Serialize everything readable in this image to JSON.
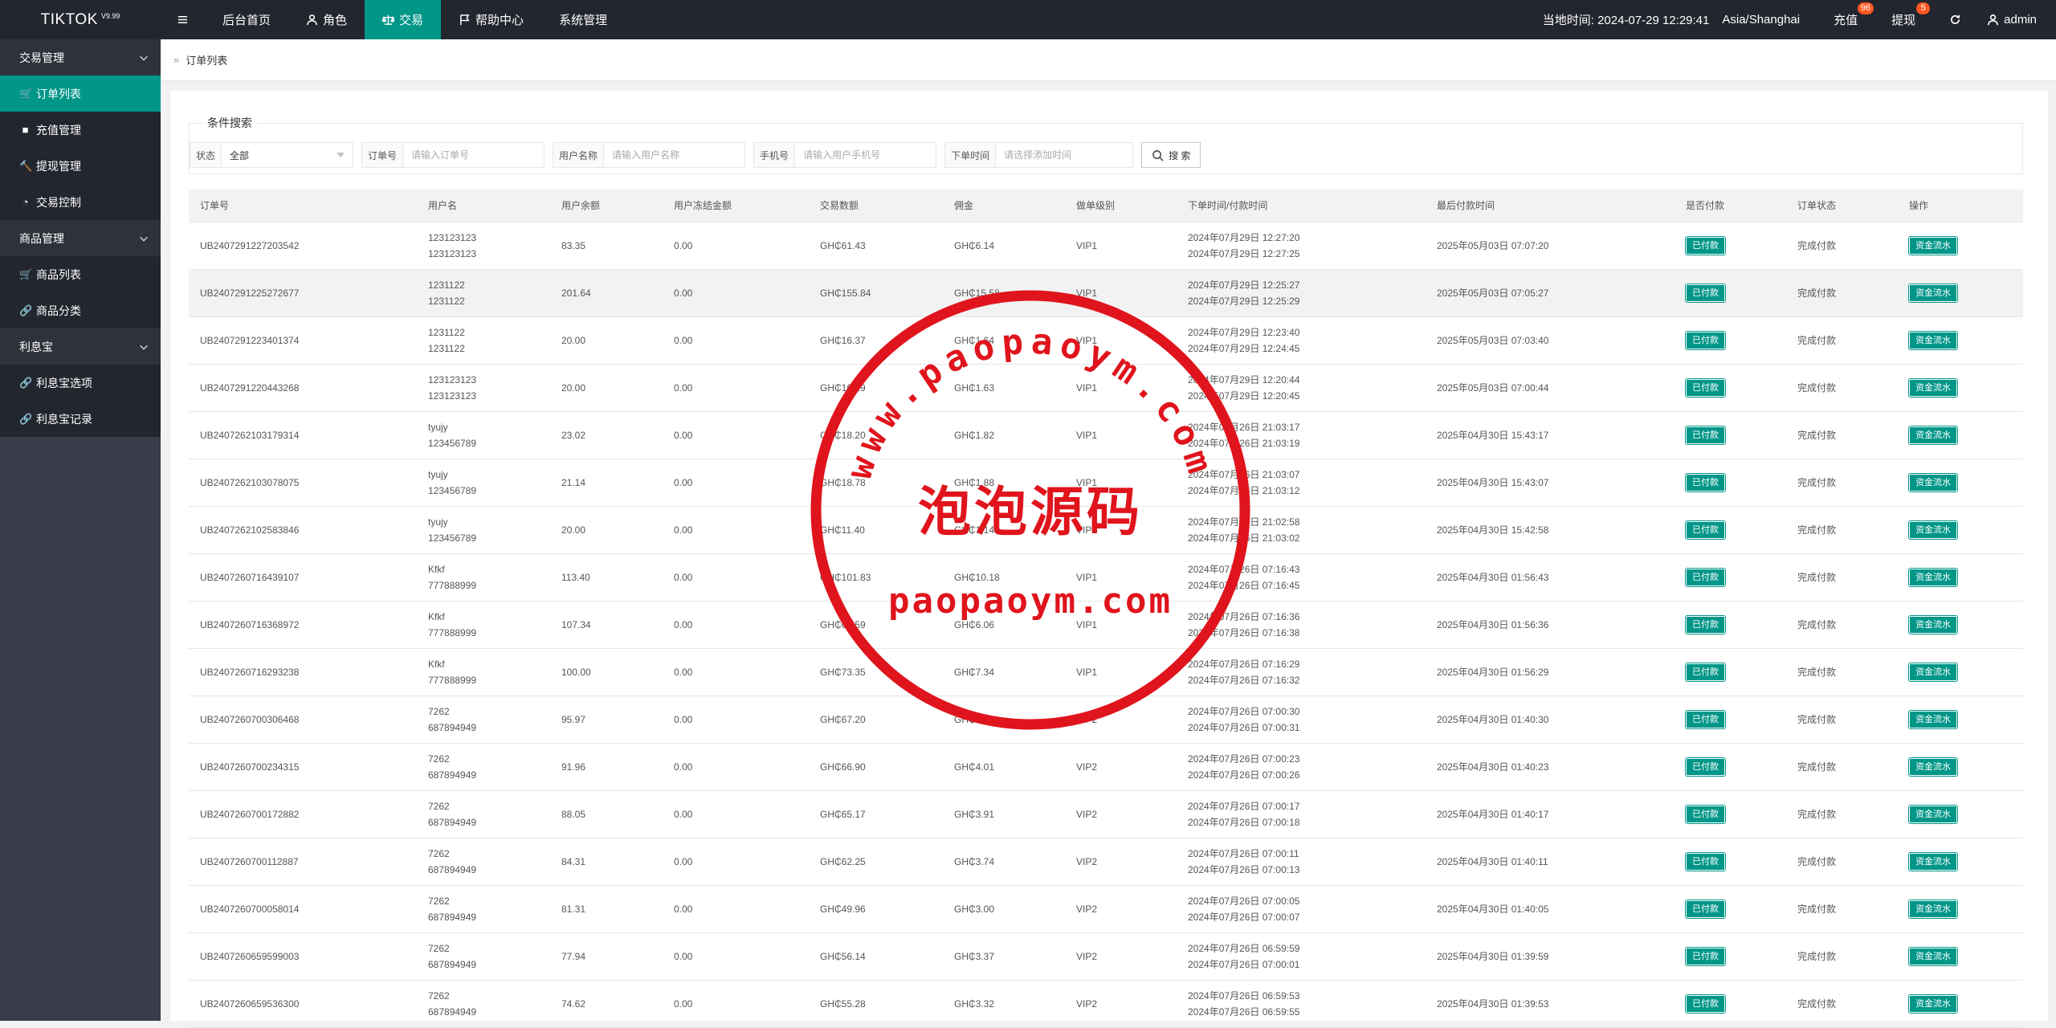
{
  "app": {
    "name": "TIKTOK",
    "version": "V9.99"
  },
  "nav": {
    "menu_icon": "hamburger-icon",
    "items": [
      {
        "label": "后台首页",
        "icon": ""
      },
      {
        "label": "角色",
        "icon": "user-icon"
      },
      {
        "label": "交易",
        "icon": "scale-icon",
        "active": true
      },
      {
        "label": "帮助中心",
        "icon": "flag-icon"
      },
      {
        "label": "系统管理",
        "icon": ""
      }
    ]
  },
  "header_right": {
    "time_label": "当地时间: 2024-07-29 12:29:41",
    "timezone": "Asia/Shanghai",
    "recharge": {
      "label": "充值",
      "badge": "96"
    },
    "withdraw": {
      "label": "提现",
      "badge": "5"
    },
    "user": "admin"
  },
  "sidebar": {
    "groups": [
      {
        "label": "交易管理",
        "items": [
          {
            "label": "订单列表",
            "icon": "cart-icon",
            "active": true
          },
          {
            "label": "充值管理",
            "icon": "comment-icon"
          },
          {
            "label": "提现管理",
            "icon": "hammer-icon"
          },
          {
            "label": "交易控制",
            "icon": "dashboard-icon"
          }
        ]
      },
      {
        "label": "商品管理",
        "items": [
          {
            "label": "商品列表",
            "icon": "cart-icon"
          },
          {
            "label": "商品分类",
            "icon": "link-icon"
          }
        ]
      },
      {
        "label": "利息宝",
        "items": [
          {
            "label": "利息宝选项",
            "icon": "link-icon"
          },
          {
            "label": "利息宝记录",
            "icon": "link-icon"
          }
        ]
      }
    ]
  },
  "breadcrumb": {
    "current": "订单列表"
  },
  "search": {
    "legend": "条件搜索",
    "status_label": "状态",
    "status_value": "全部",
    "order_label": "订单号",
    "order_placeholder": "请输入订单号",
    "username_label": "用户名称",
    "username_placeholder": "请输入用户名称",
    "phone_label": "手机号",
    "phone_placeholder": "请输入用户手机号",
    "time_label": "下单时间",
    "time_placeholder": "请选择添加时间",
    "button": "搜 索"
  },
  "table": {
    "columns": [
      "订单号",
      "用户名",
      "用户余额",
      "用户冻结金额",
      "交易数额",
      "佣金",
      "做单级别",
      "下单时间/付款时间",
      "最后付款时间",
      "是否付款",
      "订单状态",
      "操作"
    ],
    "rows": [
      {
        "id": "UB2407291227203542",
        "user1": "123123123",
        "user2": "123123123",
        "balance": "83.35",
        "frozen": "0.00",
        "amount": "GH₵61.43",
        "commission": "GH₵6.14",
        "level": "VIP1",
        "t1": "2024年07月29日 12:27:20",
        "t2": "2024年07月29日 12:27:25",
        "last": "2025年05月03日 07:07:20",
        "paid": "已付款",
        "status": "完成付款",
        "op": "资金流水"
      },
      {
        "id": "UB2407291225272677",
        "user1": "1231122",
        "user2": "1231122",
        "balance": "201.64",
        "frozen": "0.00",
        "amount": "GH₵155.84",
        "commission": "GH₵15.58",
        "level": "VIP1",
        "t1": "2024年07月29日 12:25:27",
        "t2": "2024年07月29日 12:25:29",
        "last": "2025年05月03日 07:05:27",
        "paid": "已付款",
        "status": "完成付款",
        "op": "资金流水"
      },
      {
        "id": "UB2407291223401374",
        "user1": "1231122",
        "user2": "1231122",
        "balance": "20.00",
        "frozen": "0.00",
        "amount": "GH₵16.37",
        "commission": "GH₵1.64",
        "level": "VIP1",
        "t1": "2024年07月29日 12:23:40",
        "t2": "2024年07月29日 12:24:45",
        "last": "2025年05月03日 07:03:40",
        "paid": "已付款",
        "status": "完成付款",
        "op": "资金流水"
      },
      {
        "id": "UB2407291220443268",
        "user1": "123123123",
        "user2": "123123123",
        "balance": "20.00",
        "frozen": "0.00",
        "amount": "GH₵16.29",
        "commission": "GH₵1.63",
        "level": "VIP1",
        "t1": "2024年07月29日 12:20:44",
        "t2": "2024年07月29日 12:20:45",
        "last": "2025年05月03日 07:00:44",
        "paid": "已付款",
        "status": "完成付款",
        "op": "资金流水"
      },
      {
        "id": "UB2407262103179314",
        "user1": "tyujy",
        "user2": "123456789",
        "balance": "23.02",
        "frozen": "0.00",
        "amount": "GH₵18.20",
        "commission": "GH₵1.82",
        "level": "VIP1",
        "t1": "2024年07月26日 21:03:17",
        "t2": "2024年07月26日 21:03:19",
        "last": "2025年04月30日 15:43:17",
        "paid": "已付款",
        "status": "完成付款",
        "op": "资金流水"
      },
      {
        "id": "UB2407262103078075",
        "user1": "tyujy",
        "user2": "123456789",
        "balance": "21.14",
        "frozen": "0.00",
        "amount": "GH₵18.78",
        "commission": "GH₵1.88",
        "level": "VIP1",
        "t1": "2024年07月26日 21:03:07",
        "t2": "2024年07月26日 21:03:12",
        "last": "2025年04月30日 15:43:07",
        "paid": "已付款",
        "status": "完成付款",
        "op": "资金流水"
      },
      {
        "id": "UB2407262102583846",
        "user1": "tyujy",
        "user2": "123456789",
        "balance": "20.00",
        "frozen": "0.00",
        "amount": "GH₵11.40",
        "commission": "GH₵1.14",
        "level": "VIP1",
        "t1": "2024年07月26日 21:02:58",
        "t2": "2024年07月26日 21:03:02",
        "last": "2025年04月30日 15:42:58",
        "paid": "已付款",
        "status": "完成付款",
        "op": "资金流水"
      },
      {
        "id": "UB2407260716439107",
        "user1": "Kfkf",
        "user2": "777888999",
        "balance": "113.40",
        "frozen": "0.00",
        "amount": "GH₵101.83",
        "commission": "GH₵10.18",
        "level": "VIP1",
        "t1": "2024年07月26日 07:16:43",
        "t2": "2024年07月26日 07:16:45",
        "last": "2025年04月30日 01:56:43",
        "paid": "已付款",
        "status": "完成付款",
        "op": "资金流水"
      },
      {
        "id": "UB2407260716368972",
        "user1": "Kfkf",
        "user2": "777888999",
        "balance": "107.34",
        "frozen": "0.00",
        "amount": "GH₵60.59",
        "commission": "GH₵6.06",
        "level": "VIP1",
        "t1": "2024年07月26日 07:16:36",
        "t2": "2024年07月26日 07:16:38",
        "last": "2025年04月30日 01:56:36",
        "paid": "已付款",
        "status": "完成付款",
        "op": "资金流水"
      },
      {
        "id": "UB2407260716293238",
        "user1": "Kfkf",
        "user2": "777888999",
        "balance": "100.00",
        "frozen": "0.00",
        "amount": "GH₵73.35",
        "commission": "GH₵7.34",
        "level": "VIP1",
        "t1": "2024年07月26日 07:16:29",
        "t2": "2024年07月26日 07:16:32",
        "last": "2025年04月30日 01:56:29",
        "paid": "已付款",
        "status": "完成付款",
        "op": "资金流水"
      },
      {
        "id": "UB2407260700306468",
        "user1": "7262",
        "user2": "687894949",
        "balance": "95.97",
        "frozen": "0.00",
        "amount": "GH₵67.20",
        "commission": "GH₵4.03",
        "level": "VIP2",
        "t1": "2024年07月26日 07:00:30",
        "t2": "2024年07月26日 07:00:31",
        "last": "2025年04月30日 01:40:30",
        "paid": "已付款",
        "status": "完成付款",
        "op": "资金流水"
      },
      {
        "id": "UB2407260700234315",
        "user1": "7262",
        "user2": "687894949",
        "balance": "91.96",
        "frozen": "0.00",
        "amount": "GH₵66.90",
        "commission": "GH₵4.01",
        "level": "VIP2",
        "t1": "2024年07月26日 07:00:23",
        "t2": "2024年07月26日 07:00:26",
        "last": "2025年04月30日 01:40:23",
        "paid": "已付款",
        "status": "完成付款",
        "op": "资金流水"
      },
      {
        "id": "UB2407260700172882",
        "user1": "7262",
        "user2": "687894949",
        "balance": "88.05",
        "frozen": "0.00",
        "amount": "GH₵65.17",
        "commission": "GH₵3.91",
        "level": "VIP2",
        "t1": "2024年07月26日 07:00:17",
        "t2": "2024年07月26日 07:00:18",
        "last": "2025年04月30日 01:40:17",
        "paid": "已付款",
        "status": "完成付款",
        "op": "资金流水"
      },
      {
        "id": "UB2407260700112887",
        "user1": "7262",
        "user2": "687894949",
        "balance": "84.31",
        "frozen": "0.00",
        "amount": "GH₵62.25",
        "commission": "GH₵3.74",
        "level": "VIP2",
        "t1": "2024年07月26日 07:00:11",
        "t2": "2024年07月26日 07:00:13",
        "last": "2025年04月30日 01:40:11",
        "paid": "已付款",
        "status": "完成付款",
        "op": "资金流水"
      },
      {
        "id": "UB2407260700058014",
        "user1": "7262",
        "user2": "687894949",
        "balance": "81.31",
        "frozen": "0.00",
        "amount": "GH₵49.96",
        "commission": "GH₵3.00",
        "level": "VIP2",
        "t1": "2024年07月26日 07:00:05",
        "t2": "2024年07月26日 07:00:07",
        "last": "2025年04月30日 01:40:05",
        "paid": "已付款",
        "status": "完成付款",
        "op": "资金流水"
      },
      {
        "id": "UB2407260659599003",
        "user1": "7262",
        "user2": "687894949",
        "balance": "77.94",
        "frozen": "0.00",
        "amount": "GH₵56.14",
        "commission": "GH₵3.37",
        "level": "VIP2",
        "t1": "2024年07月26日 06:59:59",
        "t2": "2024年07月26日 07:00:01",
        "last": "2025年04月30日 01:39:59",
        "paid": "已付款",
        "status": "完成付款",
        "op": "资金流水"
      },
      {
        "id": "UB2407260659536300",
        "user1": "7262",
        "user2": "687894949",
        "balance": "74.62",
        "frozen": "0.00",
        "amount": "GH₵55.28",
        "commission": "GH₵3.32",
        "level": "VIP2",
        "t1": "2024年07月26日 06:59:53",
        "t2": "2024年07月26日 06:59:55",
        "last": "2025年04月30日 01:39:53",
        "paid": "已付款",
        "status": "完成付款",
        "op": "资金流水"
      }
    ]
  },
  "watermark": {
    "arc_text": "www.paopaoym.com",
    "center_text": "泡泡源码",
    "bottom_text": "paopaoym.com",
    "color": "#e0141c"
  },
  "colors": {
    "accent": "#009688",
    "topbar": "#23262e",
    "sidebar": "#393d49",
    "badge": "#ff5722"
  }
}
